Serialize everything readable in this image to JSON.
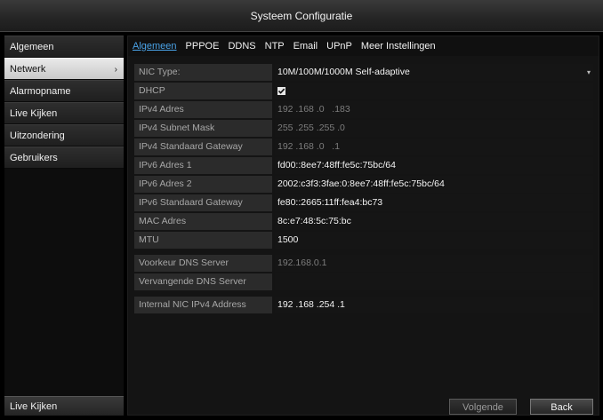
{
  "window": {
    "title": "Systeem Configuratie"
  },
  "sidebar": {
    "items": [
      {
        "label": "Algemeen"
      },
      {
        "label": "Netwerk",
        "active": true
      },
      {
        "label": "Alarmopname"
      },
      {
        "label": "Live Kijken"
      },
      {
        "label": "Uitzondering"
      },
      {
        "label": "Gebruikers"
      }
    ],
    "bottom_label": "Live Kijken"
  },
  "tabs": [
    "Algemeen",
    "PPPOE",
    "DDNS",
    "NTP",
    "Email",
    "UPnP",
    "Meer Instellingen"
  ],
  "active_tab": "Algemeen",
  "form": {
    "nic_type": {
      "label": "NIC Type:",
      "value": "10M/100M/1000M Self-adaptive"
    },
    "dhcp": {
      "label": "DHCP",
      "checked": true
    },
    "ipv4_address": {
      "label": "IPv4 Adres",
      "value": "192 .168 .0   .183"
    },
    "ipv4_subnet": {
      "label": "IPv4 Subnet Mask",
      "value": "255 .255 .255 .0"
    },
    "ipv4_gateway": {
      "label": "IPv4 Standaard Gateway",
      "value": "192 .168 .0   .1"
    },
    "ipv6_address1": {
      "label": "IPv6 Adres 1",
      "value": "fd00::8ee7:48ff:fe5c:75bc/64"
    },
    "ipv6_address2": {
      "label": "IPv6 Adres 2",
      "value": "2002:c3f3:3fae:0:8ee7:48ff:fe5c:75bc/64"
    },
    "ipv6_gateway": {
      "label": "IPv6 Standaard Gateway",
      "value": "fe80::2665:11ff:fea4:bc73"
    },
    "mac_address": {
      "label": "MAC Adres",
      "value": "8c:e7:48:5c:75:bc"
    },
    "mtu": {
      "label": "MTU",
      "value": "1500"
    },
    "preferred_dns": {
      "label": "Voorkeur DNS Server",
      "value": "192.168.0.1"
    },
    "alternate_dns": {
      "label": "Vervangende DNS Server",
      "value": ""
    },
    "internal_nic": {
      "label": "Internal NIC IPv4 Address",
      "value": "192 .168 .254 .1"
    }
  },
  "buttons": {
    "next": "Volgende",
    "back": "Back"
  },
  "colors": {
    "accent": "#4aa3e8",
    "active_item_bg": "#d9d9d9"
  }
}
